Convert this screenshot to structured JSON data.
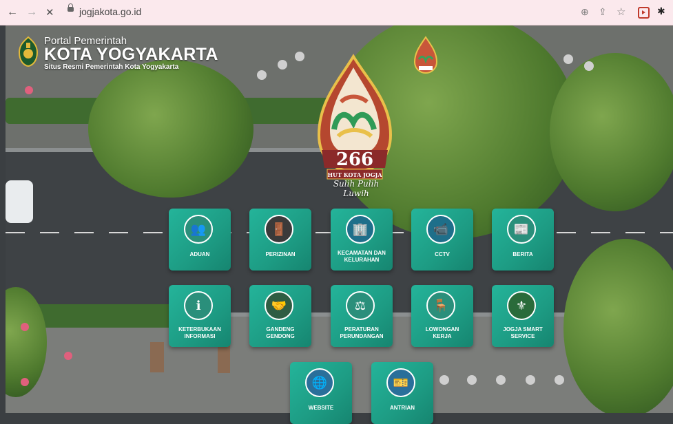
{
  "browser": {
    "url": "jogjakota.go.id",
    "nav_back": "←",
    "nav_forward": "→",
    "nav_stop": "✕"
  },
  "header": {
    "title_small": "Portal Pemerintah",
    "title_city": "KOTA YOGYAKARTA",
    "subtitle": "Situs Resmi Pemerintah Kota Yogyakarta"
  },
  "anniversary": {
    "number": "266",
    "banner": "HUT KOTA JOGJA",
    "tagline": "Sulih Pulih Luwih"
  },
  "tiles": [
    {
      "line1": "ADUAN",
      "line2": "",
      "icon": "complaint-people-icon"
    },
    {
      "line1": "PERIZINAN",
      "line2": "",
      "icon": "permit-door-icon"
    },
    {
      "line1": "KECAMATAN DAN",
      "line2": "KELURAHAN",
      "icon": "office-desk-icon"
    },
    {
      "line1": "CCTV",
      "line2": "",
      "icon": "cctv-camera-icon"
    },
    {
      "line1": "BERITA",
      "line2": "",
      "icon": "newspaper-icon"
    },
    {
      "line1": "KETERBUKAAN",
      "line2": "INFORMASI",
      "icon": "info-magnifier-icon"
    },
    {
      "line1": "GANDENG",
      "line2": "GENDONG",
      "icon": "people-carry-icon"
    },
    {
      "line1": "PERATURAN",
      "line2": "PERUNDANGAN",
      "icon": "scales-icon"
    },
    {
      "line1": "LOWONGAN",
      "line2": "KERJA",
      "icon": "office-chair-icon"
    },
    {
      "line1": "JOGJA SMART",
      "line2": "SERVICE",
      "icon": "city-emblem-icon"
    },
    {
      "line1": "WEBSITE",
      "line2": "",
      "icon": "website-globe-icon"
    },
    {
      "line1": "ANTRIAN",
      "line2": "",
      "icon": "queue-ticket-icon"
    }
  ],
  "colors": {
    "tile": "#1fa88e",
    "chrome": "#fbe9ed"
  }
}
